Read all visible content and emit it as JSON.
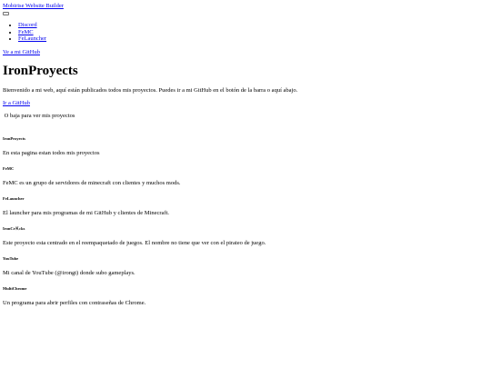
{
  "header": {
    "logo_alt": "Mobirise Website Builder",
    "nav": [
      {
        "label": "Discord"
      },
      {
        "label": "FeMC"
      },
      {
        "label": "FeLauncher"
      }
    ],
    "github_button": "Ve a mi GitHub"
  },
  "hero": {
    "title": "IronProyects",
    "intro": "Bienvenido a mi web, aquí están publicados todos mis proyectos. Puedes ir a mi GitHub en el botón de la barra o aquí abajo.",
    "github_link": "Ir a GitHub",
    "scroll_hint": "O baja para ver mis proyectos"
  },
  "projects": [
    {
      "title": "IronProyects",
      "description": "En esta pagina estan todos mis proyectos"
    },
    {
      "title": "FeMC",
      "description": "FeMC es un grupo de servidores de minecraft con clientes y muchos mods."
    },
    {
      "title": "FeLauncher",
      "description": "El launcher para mis programas de mi GitHub y clientes de Minecraft."
    },
    {
      "title": "IronCrＫcks",
      "description": "Este proyecto esta centrado en el reempaquetado de juegos. El nombre no tiene que ver con el pirateo de juego."
    },
    {
      "title": "YouTube",
      "description": "Mi canal de YouTube (@irongt) donde subo gameplays."
    },
    {
      "title": "MultiChrome",
      "description": "Un programa para abrir perfiles con contraseñas de Chrome."
    }
  ]
}
